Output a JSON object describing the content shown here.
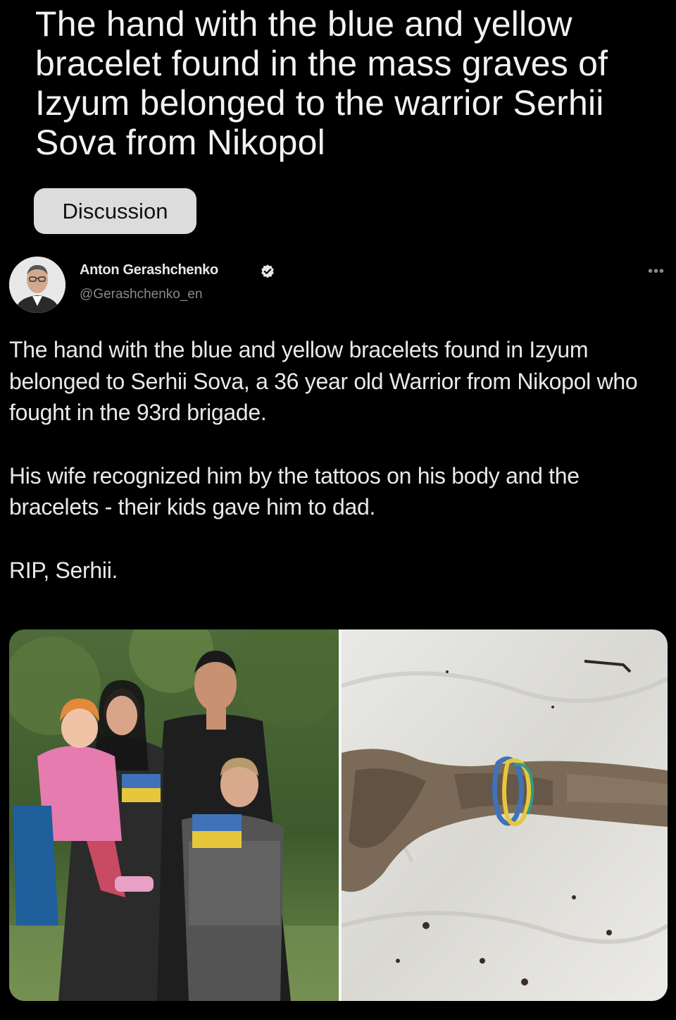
{
  "post": {
    "title": "The hand with the blue and yellow bracelet found in the mass graves of Izyum belonged to the warrior Serhii Sova from Nikopol",
    "flair": "Discussion"
  },
  "tweet": {
    "author_name": "Anton Gerashchenko",
    "handle": "@Gerashchenko_en",
    "more_icon": "more-horizontal-icon",
    "verified_icon": "verified-badge-icon",
    "paragraphs": [
      "The hand with the blue and yellow bracelets found in Izyum belonged to Serhii Sova, a 36 year old Warrior from Nikopol who fought in the 93rd brigade.",
      "His wife recognized him by the tattoos on his body and the bracelets - their kids gave him to dad.",
      "RIP, Serhii."
    ]
  },
  "colors": {
    "background": "#000000",
    "flair_bg": "#dcdcdc",
    "verified": "#e6e6e6",
    "flag_blue": "#3f72b8",
    "flag_yellow": "#e6c73c"
  }
}
